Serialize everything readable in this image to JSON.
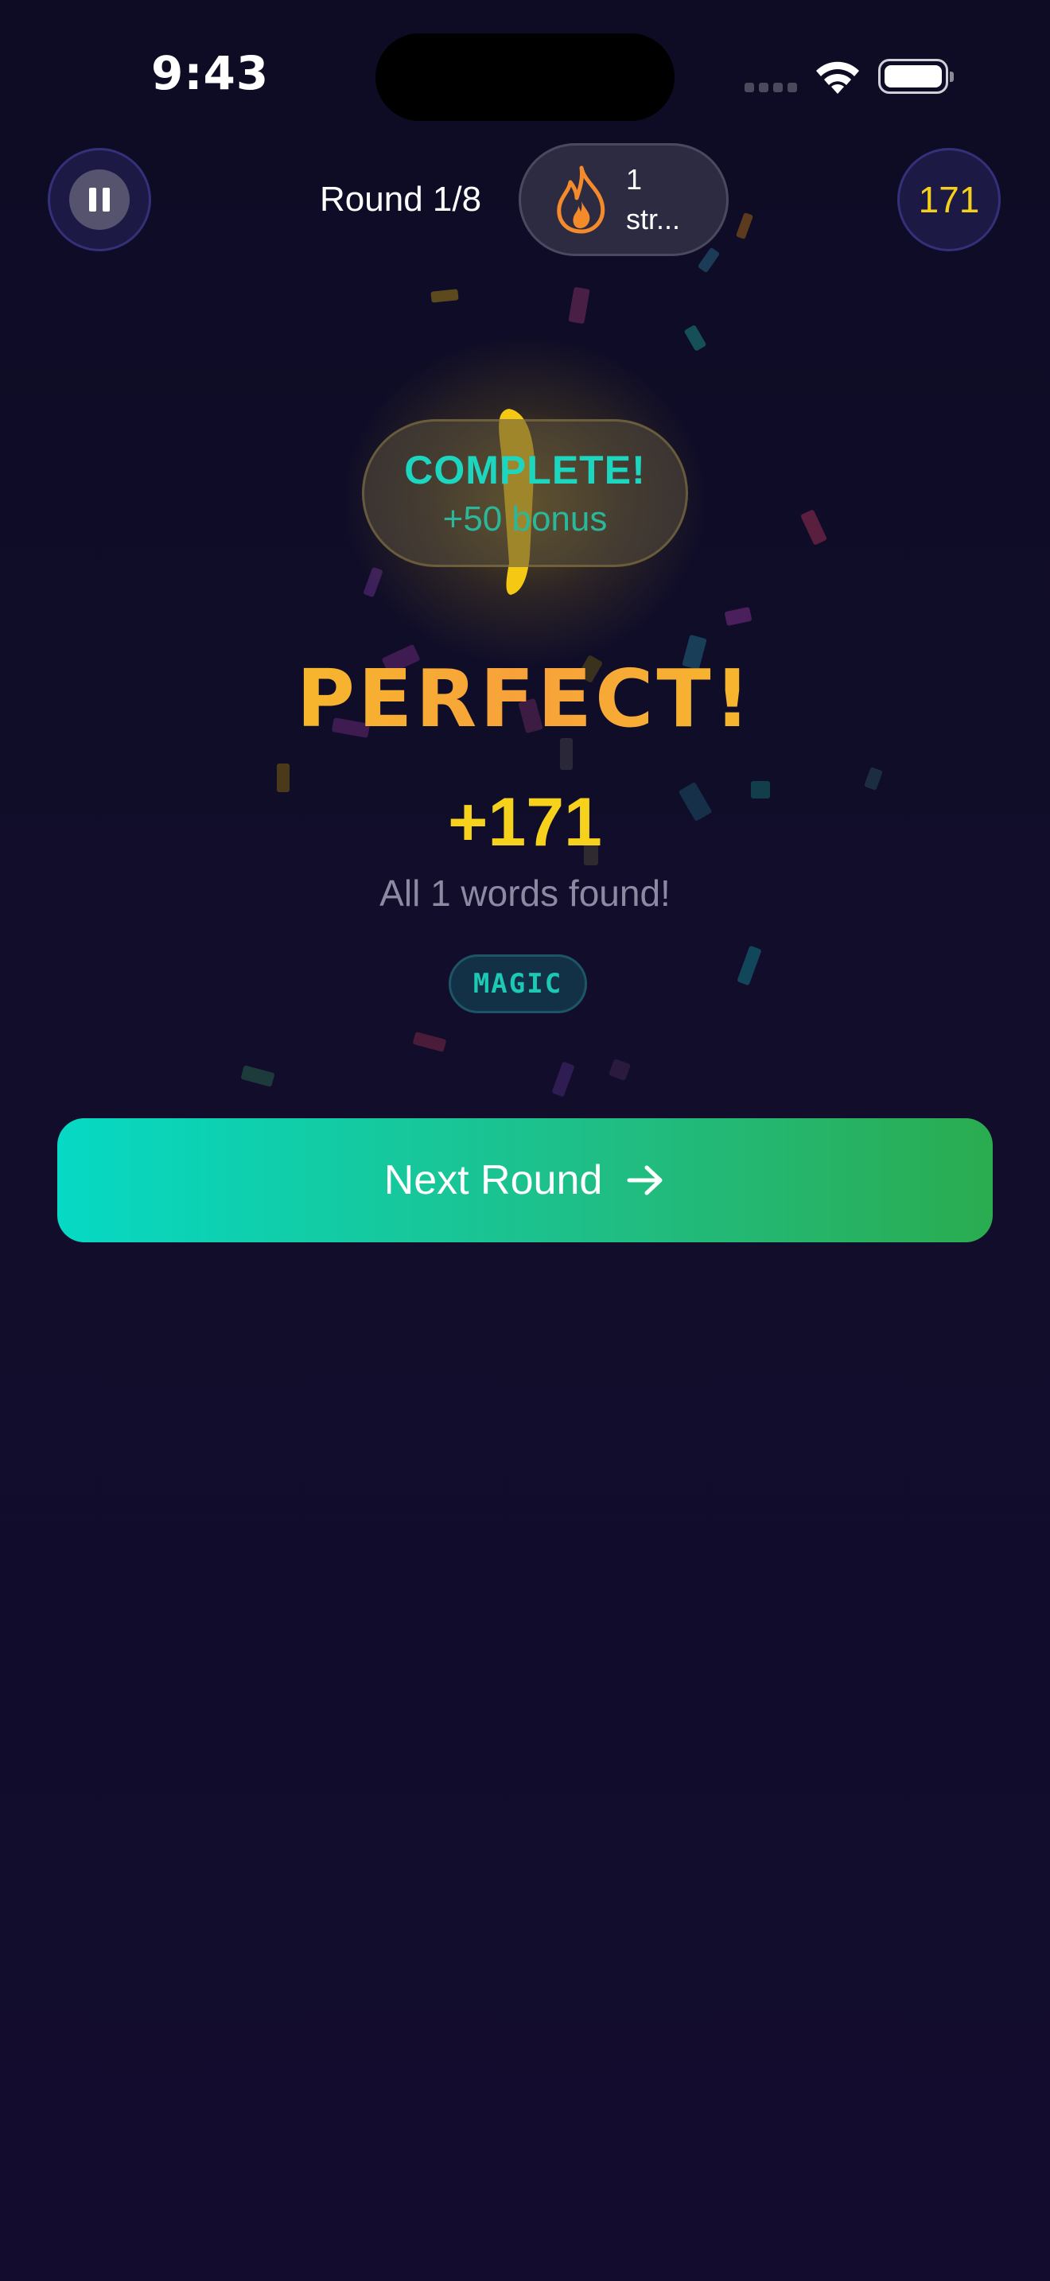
{
  "status_bar": {
    "time": "9:43"
  },
  "top_bar": {
    "round_label": "Round 1/8",
    "streak_text": "1 str...",
    "score": "171"
  },
  "result": {
    "badge_title": "COMPLETE!",
    "badge_bonus": "+50 bonus",
    "headline": "PERFECT!",
    "points": "+171",
    "summary": "All 1 words found!",
    "found_words": [
      "MAGIC"
    ]
  },
  "actions": {
    "next_label": "Next Round"
  },
  "colors": {
    "accent_teal": "#1dd6c0",
    "accent_gold": "#f7d21c",
    "flame_orange": "#f58a2a",
    "background": "#110d2a"
  },
  "icons": {
    "pause": "pause-icon",
    "streak": "flame-icon",
    "next": "arrow-right-icon"
  }
}
